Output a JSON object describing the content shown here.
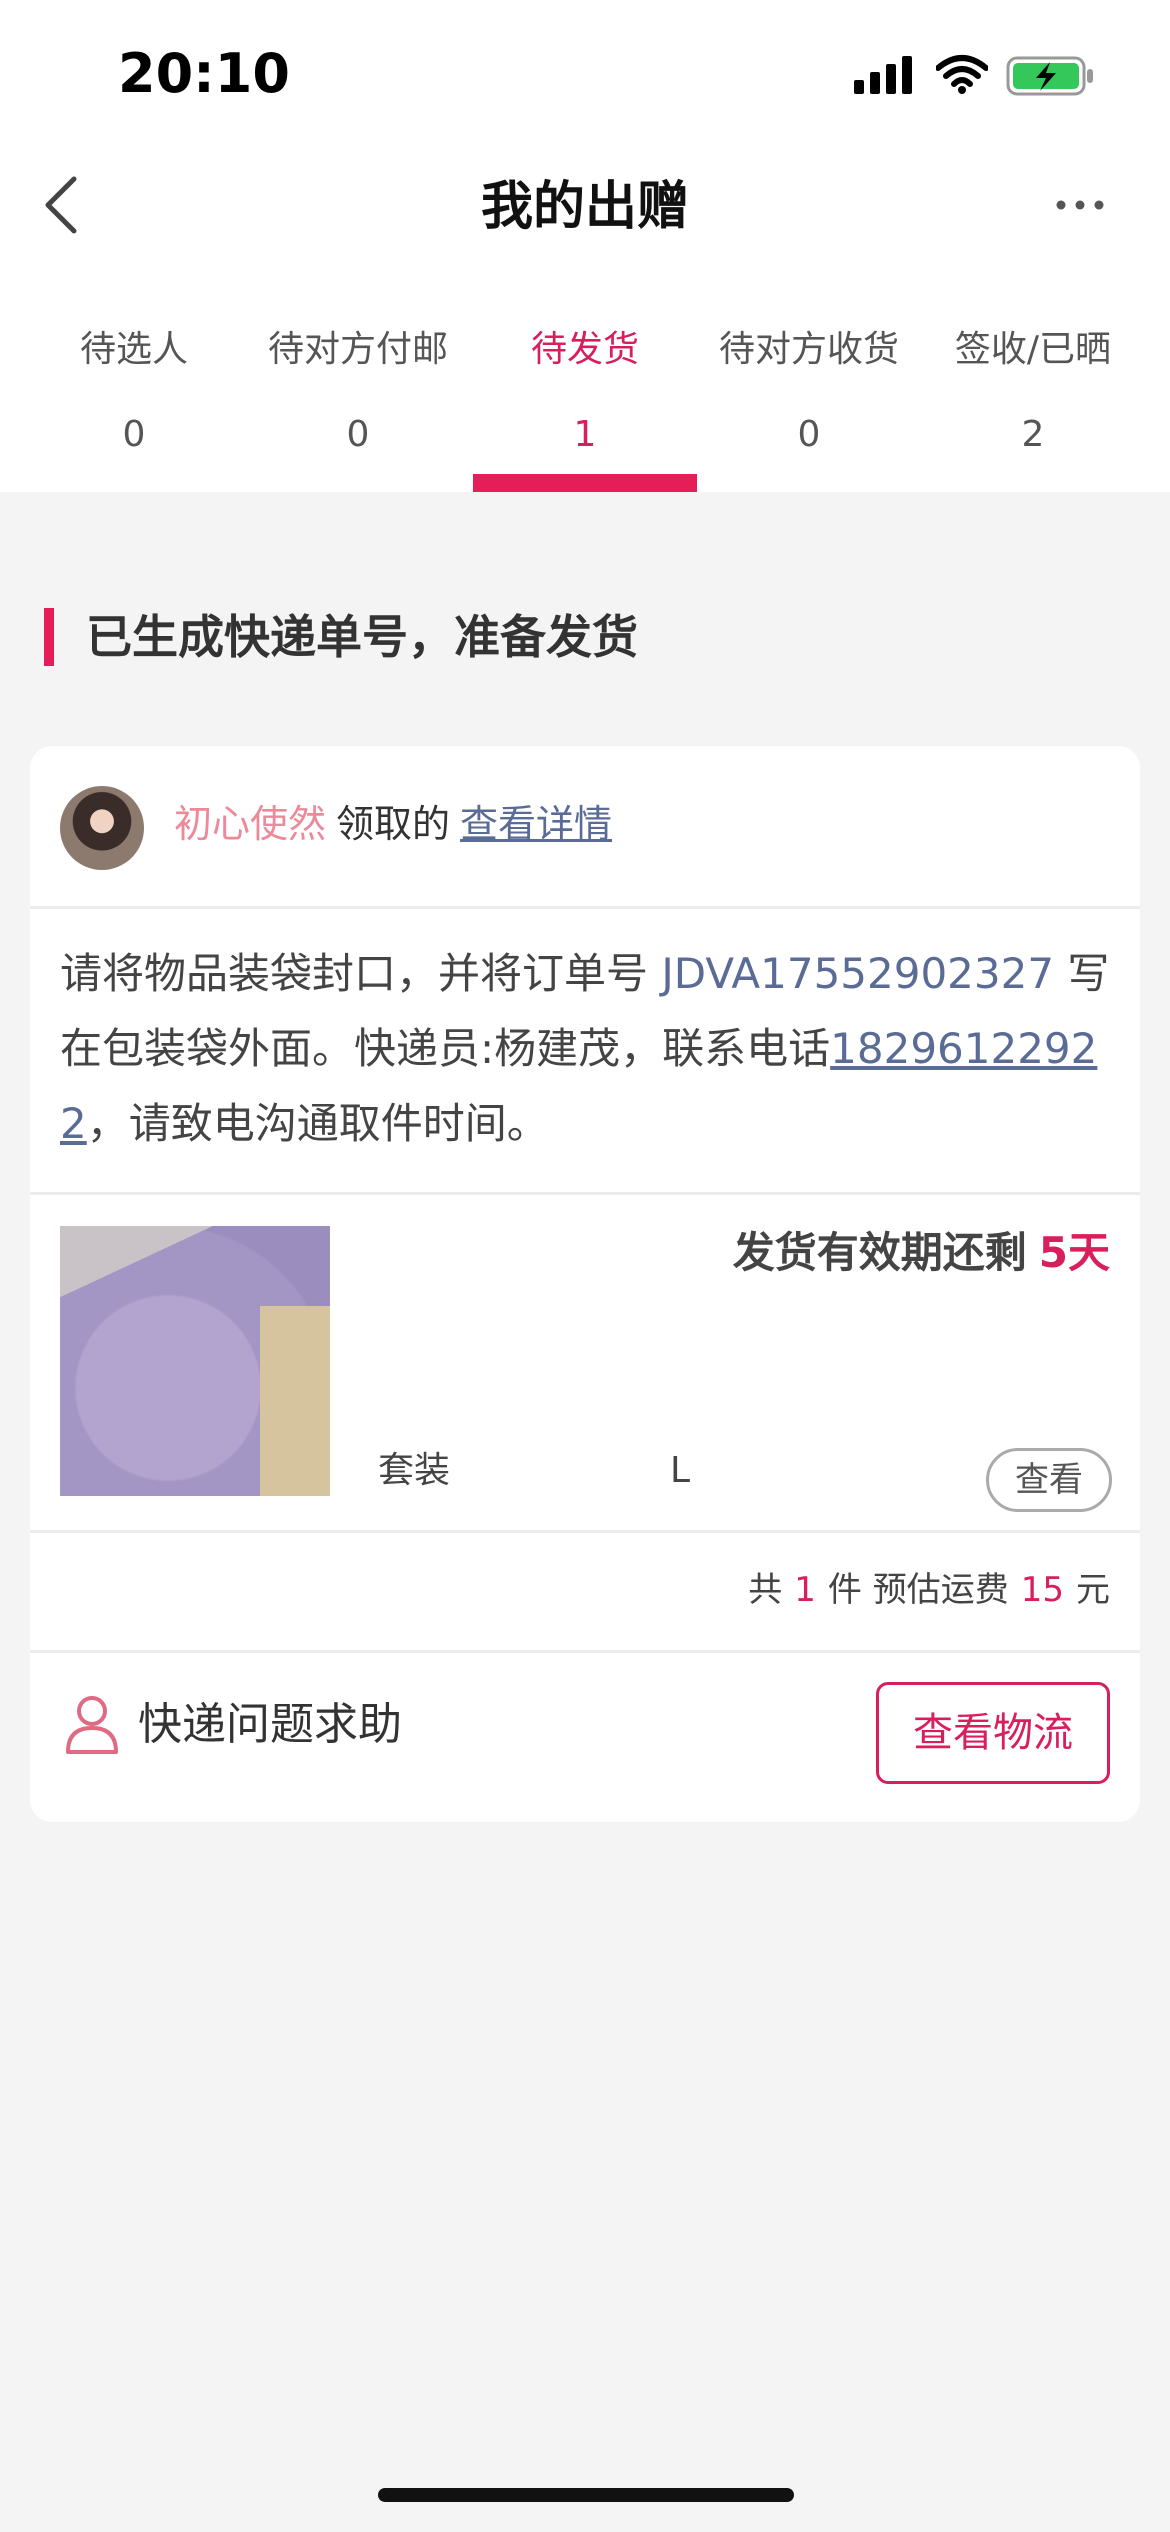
{
  "status_bar": {
    "time": "20:10"
  },
  "nav": {
    "title": "我的出赠",
    "back_icon": "chevron-left-icon",
    "more_icon": "more-horizontal-icon"
  },
  "tabs": [
    {
      "label": "待选人",
      "count": "0"
    },
    {
      "label": "待对方付邮",
      "count": "0"
    },
    {
      "label": "待发货",
      "count": "1",
      "active": true
    },
    {
      "label": "待对方收货",
      "count": "0"
    },
    {
      "label": "签收/已晒",
      "count": "2"
    }
  ],
  "section": {
    "title": "已生成快递单号，准备发货"
  },
  "card": {
    "claimer": "初心使然",
    "claim_verb": "领取的",
    "detail_link": "查看详情",
    "instruction": {
      "part1": "请将物品装袋封口，并将订单号 ",
      "order_no": "JDVA17552902327",
      "part2": " 写在包装袋外面。快递员:杨建茂，联系电话",
      "phone": "18296122922",
      "part3": "，请致电沟通取件时间。"
    },
    "expiry_label": "发货有效期还剩",
    "expiry_days": "5天",
    "product": {
      "name": "套装",
      "size": "L",
      "view_button": "查看"
    },
    "summary": {
      "prefix": "共",
      "count": "1",
      "mid": "件 预估运费",
      "fee": "15",
      "unit": "元"
    },
    "help_text": "快递问题求助",
    "logistics_button": "查看物流"
  },
  "colors": {
    "accent": "#e51e5a",
    "link": "#5a6b96",
    "claimer": "#ec8a9a"
  }
}
